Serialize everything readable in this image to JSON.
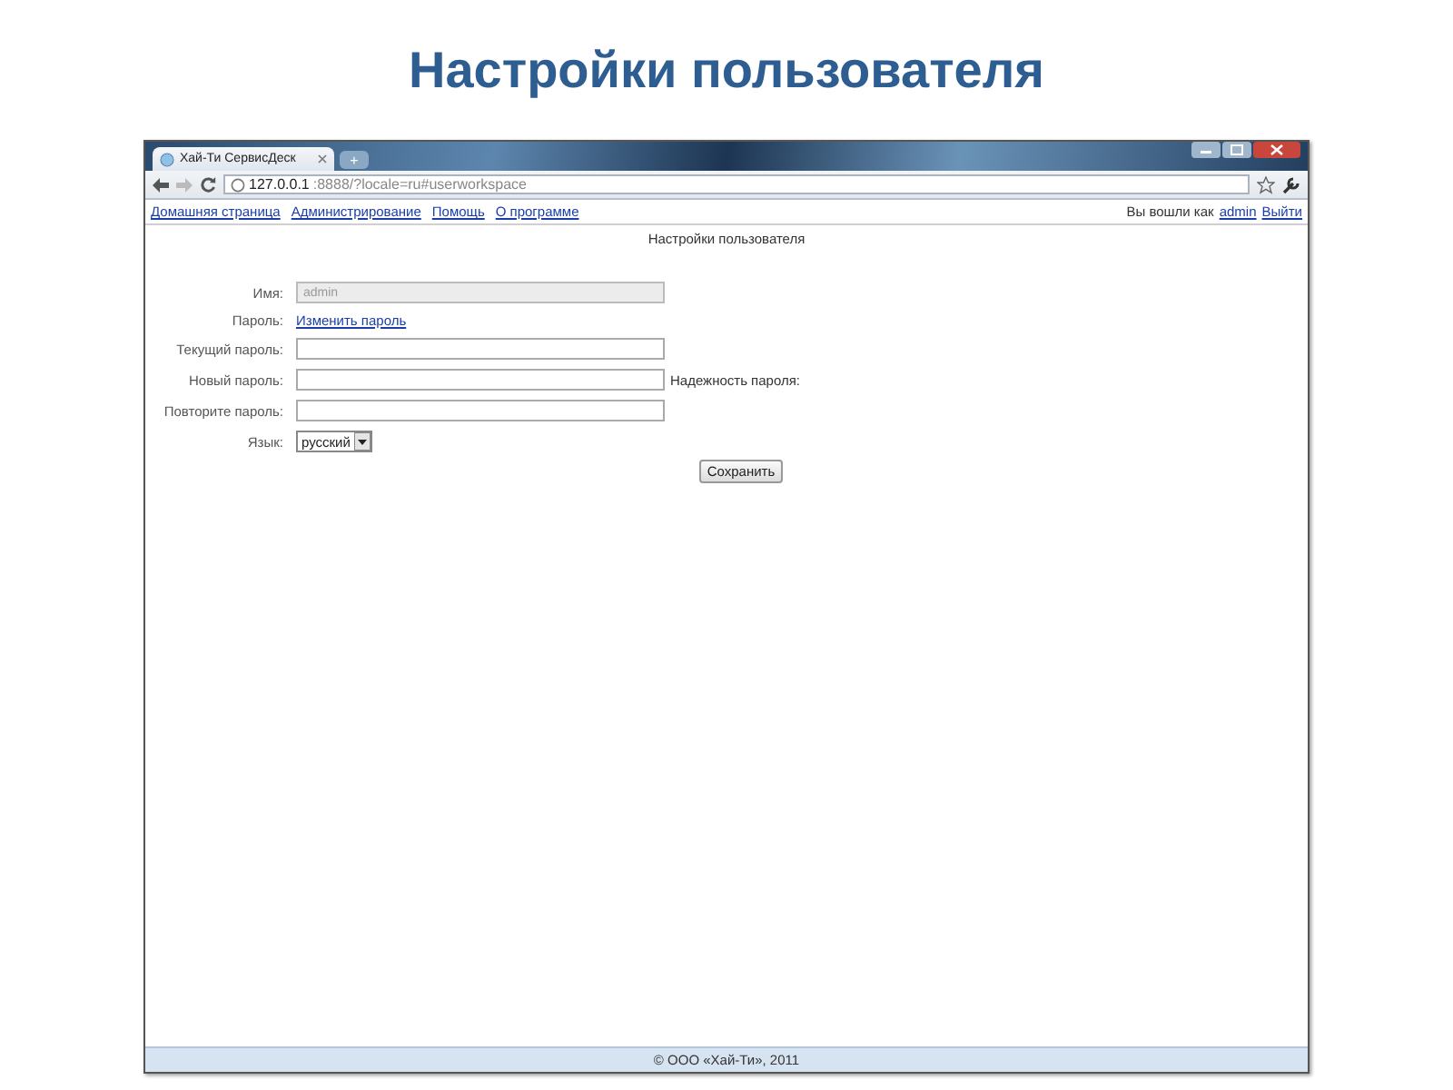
{
  "slide_title": "Настройки пользователя",
  "browser": {
    "tab_title": "Хай-Ти СервисДеск",
    "new_tab": "+",
    "url_host": "127.0.0.1",
    "url_rest": ":8888/?locale=ru#userworkspace"
  },
  "nav": {
    "links": [
      "Домашняя страница",
      "Администрирование",
      "Помощь",
      "О программе"
    ],
    "login_text": "Вы вошли как",
    "user": "admin",
    "logout": "Выйти"
  },
  "page_title": "Настройки пользователя",
  "form": {
    "rows": [
      {
        "kind": "field",
        "label": "Имя:",
        "value": "admin",
        "disabled": true
      },
      {
        "kind": "link",
        "label": "Пароль:",
        "link": "Изменить пароль"
      },
      {
        "kind": "field",
        "label": "Текущий пароль:",
        "disabled": false
      },
      {
        "kind": "field",
        "label": "Новый пароль:",
        "disabled": false,
        "note": "Надежность пароля:"
      },
      {
        "kind": "field",
        "label": "Повторите пароль:",
        "disabled": false
      },
      {
        "kind": "select",
        "label": "Язык:",
        "value": "русский"
      }
    ],
    "submit": "Сохранить"
  },
  "footer": "© ООО «Хай-Ти», 2011"
}
